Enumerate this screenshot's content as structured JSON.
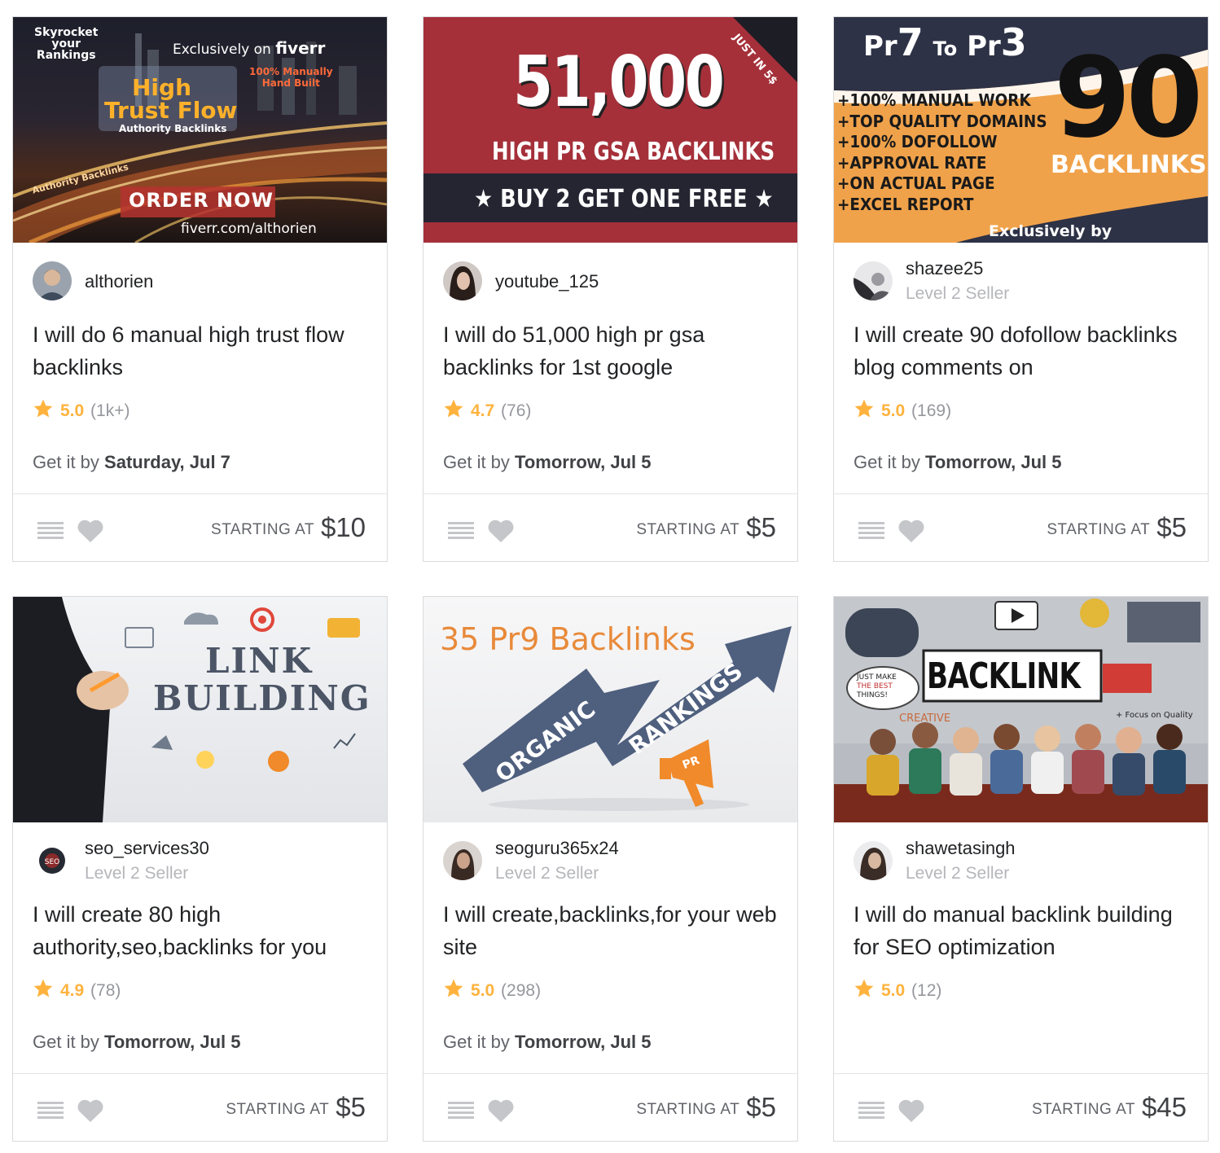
{
  "cards": [
    {
      "seller": {
        "name": "althorien",
        "level": ""
      },
      "title": "I will do 6 manual high trust flow backlinks",
      "rating": {
        "score": "5.0",
        "count": "(1k+)"
      },
      "delivery": {
        "prefix": "Get it by",
        "date": "Saturday, Jul 7"
      },
      "price": {
        "label": "STARTING AT",
        "value": "$10"
      },
      "banner": {
        "line1": "Skyrocket",
        "line2": "your",
        "line3": "Rankings",
        "exclusively": "Exclusively on",
        "brand": "fiverr",
        "manual1": "100% Manually",
        "manual2": "Hand Built",
        "high": "High",
        "trust": "Trust Flow",
        "authority": "Authority Backlinks",
        "road": "Authority Backlinks",
        "cta": "ORDER NOW",
        "url": "fiverr.com/althorien"
      }
    },
    {
      "seller": {
        "name": "youtube_125",
        "level": ""
      },
      "title": "I will do 51,000 high pr gsa backlinks for 1st google",
      "rating": {
        "score": "4.7",
        "count": "(76)"
      },
      "delivery": {
        "prefix": "Get it by",
        "date": "Tomorrow, Jul 5"
      },
      "price": {
        "label": "STARTING AT",
        "value": "$5"
      },
      "banner": {
        "corner": "JUST IN 5$",
        "big": "51,000",
        "sub": "HIGH PR GSA BACKLINKS",
        "offer": "★ BUY 2 GET ONE FREE ★"
      }
    },
    {
      "seller": {
        "name": "shazee25",
        "level": "Level 2 Seller"
      },
      "title": "I will create 90 dofollow backlinks blog comments on",
      "rating": {
        "score": "5.0",
        "count": "(169)"
      },
      "delivery": {
        "prefix": "Get it by",
        "date": "Tomorrow, Jul 5"
      },
      "price": {
        "label": "STARTING AT",
        "value": "$5"
      },
      "banner": {
        "pr_a": "Pr",
        "pr_a_num": "7",
        "to": "To",
        "pr_b": "Pr",
        "pr_b_num": "3",
        "features": [
          "+100% MANUAL WORK",
          "+TOP QUALITY DOMAINS",
          "+100% DOFOLLOW",
          "+APPROVAL RATE",
          "+ON ACTUAL PAGE",
          "+EXCEL REPORT"
        ],
        "big": "90",
        "backlinks": "BACKLINKS",
        "exclusively": "Exclusively by"
      }
    },
    {
      "seller": {
        "name": "seo_services30",
        "level": "Level 2 Seller"
      },
      "title": "I will create 80 high authority,seo,backlinks for you",
      "rating": {
        "score": "4.9",
        "count": "(78)"
      },
      "delivery": {
        "prefix": "Get it by",
        "date": "Tomorrow, Jul 5"
      },
      "price": {
        "label": "STARTING AT",
        "value": "$5"
      },
      "banner": {
        "line1": "LINK",
        "line2": "BUILDING"
      }
    },
    {
      "seller": {
        "name": "seoguru365x24",
        "level": "Level 2 Seller"
      },
      "title": "I will create,backlinks,for your web site",
      "rating": {
        "score": "5.0",
        "count": "(298)"
      },
      "delivery": {
        "prefix": "Get it by",
        "date": "Tomorrow, Jul 5"
      },
      "price": {
        "label": "STARTING AT",
        "value": "$5"
      },
      "banner": {
        "headline": "35 Pr9 Backlinks",
        "organic": "ORGANIC",
        "rankings": "RANKINGS",
        "pr": "PR"
      }
    },
    {
      "seller": {
        "name": "shawetasingh",
        "level": "Level 2 Seller"
      },
      "title": "I will do manual backlink building for SEO optimization",
      "rating": {
        "score": "5.0",
        "count": "(12)"
      },
      "delivery": {
        "prefix": "",
        "date": ""
      },
      "price": {
        "label": "STARTING AT",
        "value": "$45"
      },
      "banner": {
        "word": "BACKLINK",
        "note1": "JUST MAKE",
        "note2": "THE BEST",
        "note3": "THINGS!",
        "creative": "CREATIVE",
        "focus": "+ Focus on Quality"
      }
    }
  ],
  "colors": {
    "star": "#ffb33e",
    "text": "#222325",
    "muted": "#62646a",
    "level": "#b5b6ba"
  }
}
